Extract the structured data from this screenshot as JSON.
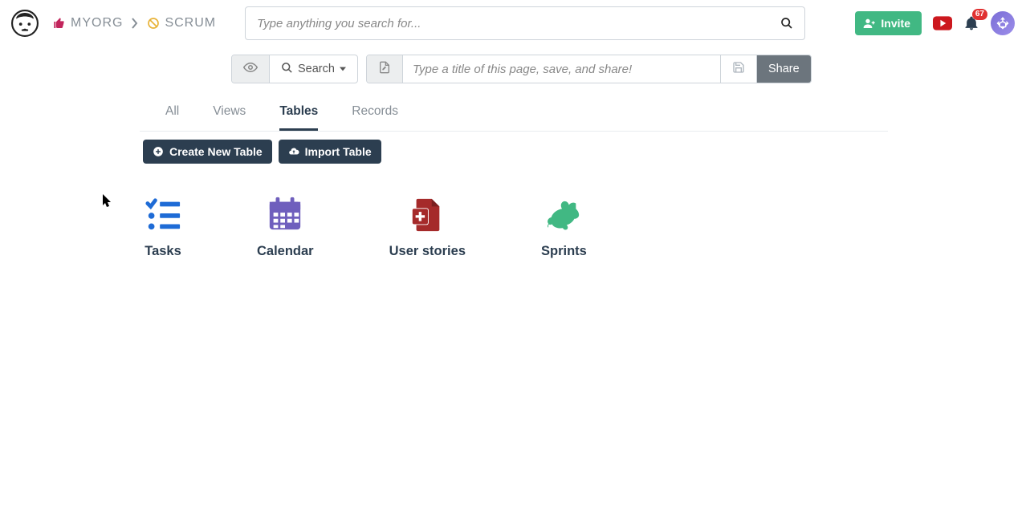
{
  "breadcrumbs": {
    "org": "MYORG",
    "project": "SCRUM"
  },
  "search": {
    "placeholder": "Type anything you search for..."
  },
  "toolbar": {
    "search_label": "Search",
    "page_title_placeholder": "Type a title of this page, save, and share!",
    "share_label": "Share"
  },
  "invite_label": "Invite",
  "notifications": {
    "count": "67"
  },
  "tabs": [
    {
      "label": "All",
      "active": false
    },
    {
      "label": "Views",
      "active": false
    },
    {
      "label": "Tables",
      "active": true
    },
    {
      "label": "Records",
      "active": false
    }
  ],
  "buttons": {
    "create_table": "Create New Table",
    "import_table": "Import Table"
  },
  "tiles": [
    {
      "name": "Tasks",
      "icon": "tasks-icon",
      "color": "blue"
    },
    {
      "name": "Calendar",
      "icon": "calendar-icon",
      "color": "purple"
    },
    {
      "name": "User stories",
      "icon": "doc-plus-icon",
      "color": "crimson"
    },
    {
      "name": "Sprints",
      "icon": "rabbit-icon",
      "color": "green"
    }
  ]
}
